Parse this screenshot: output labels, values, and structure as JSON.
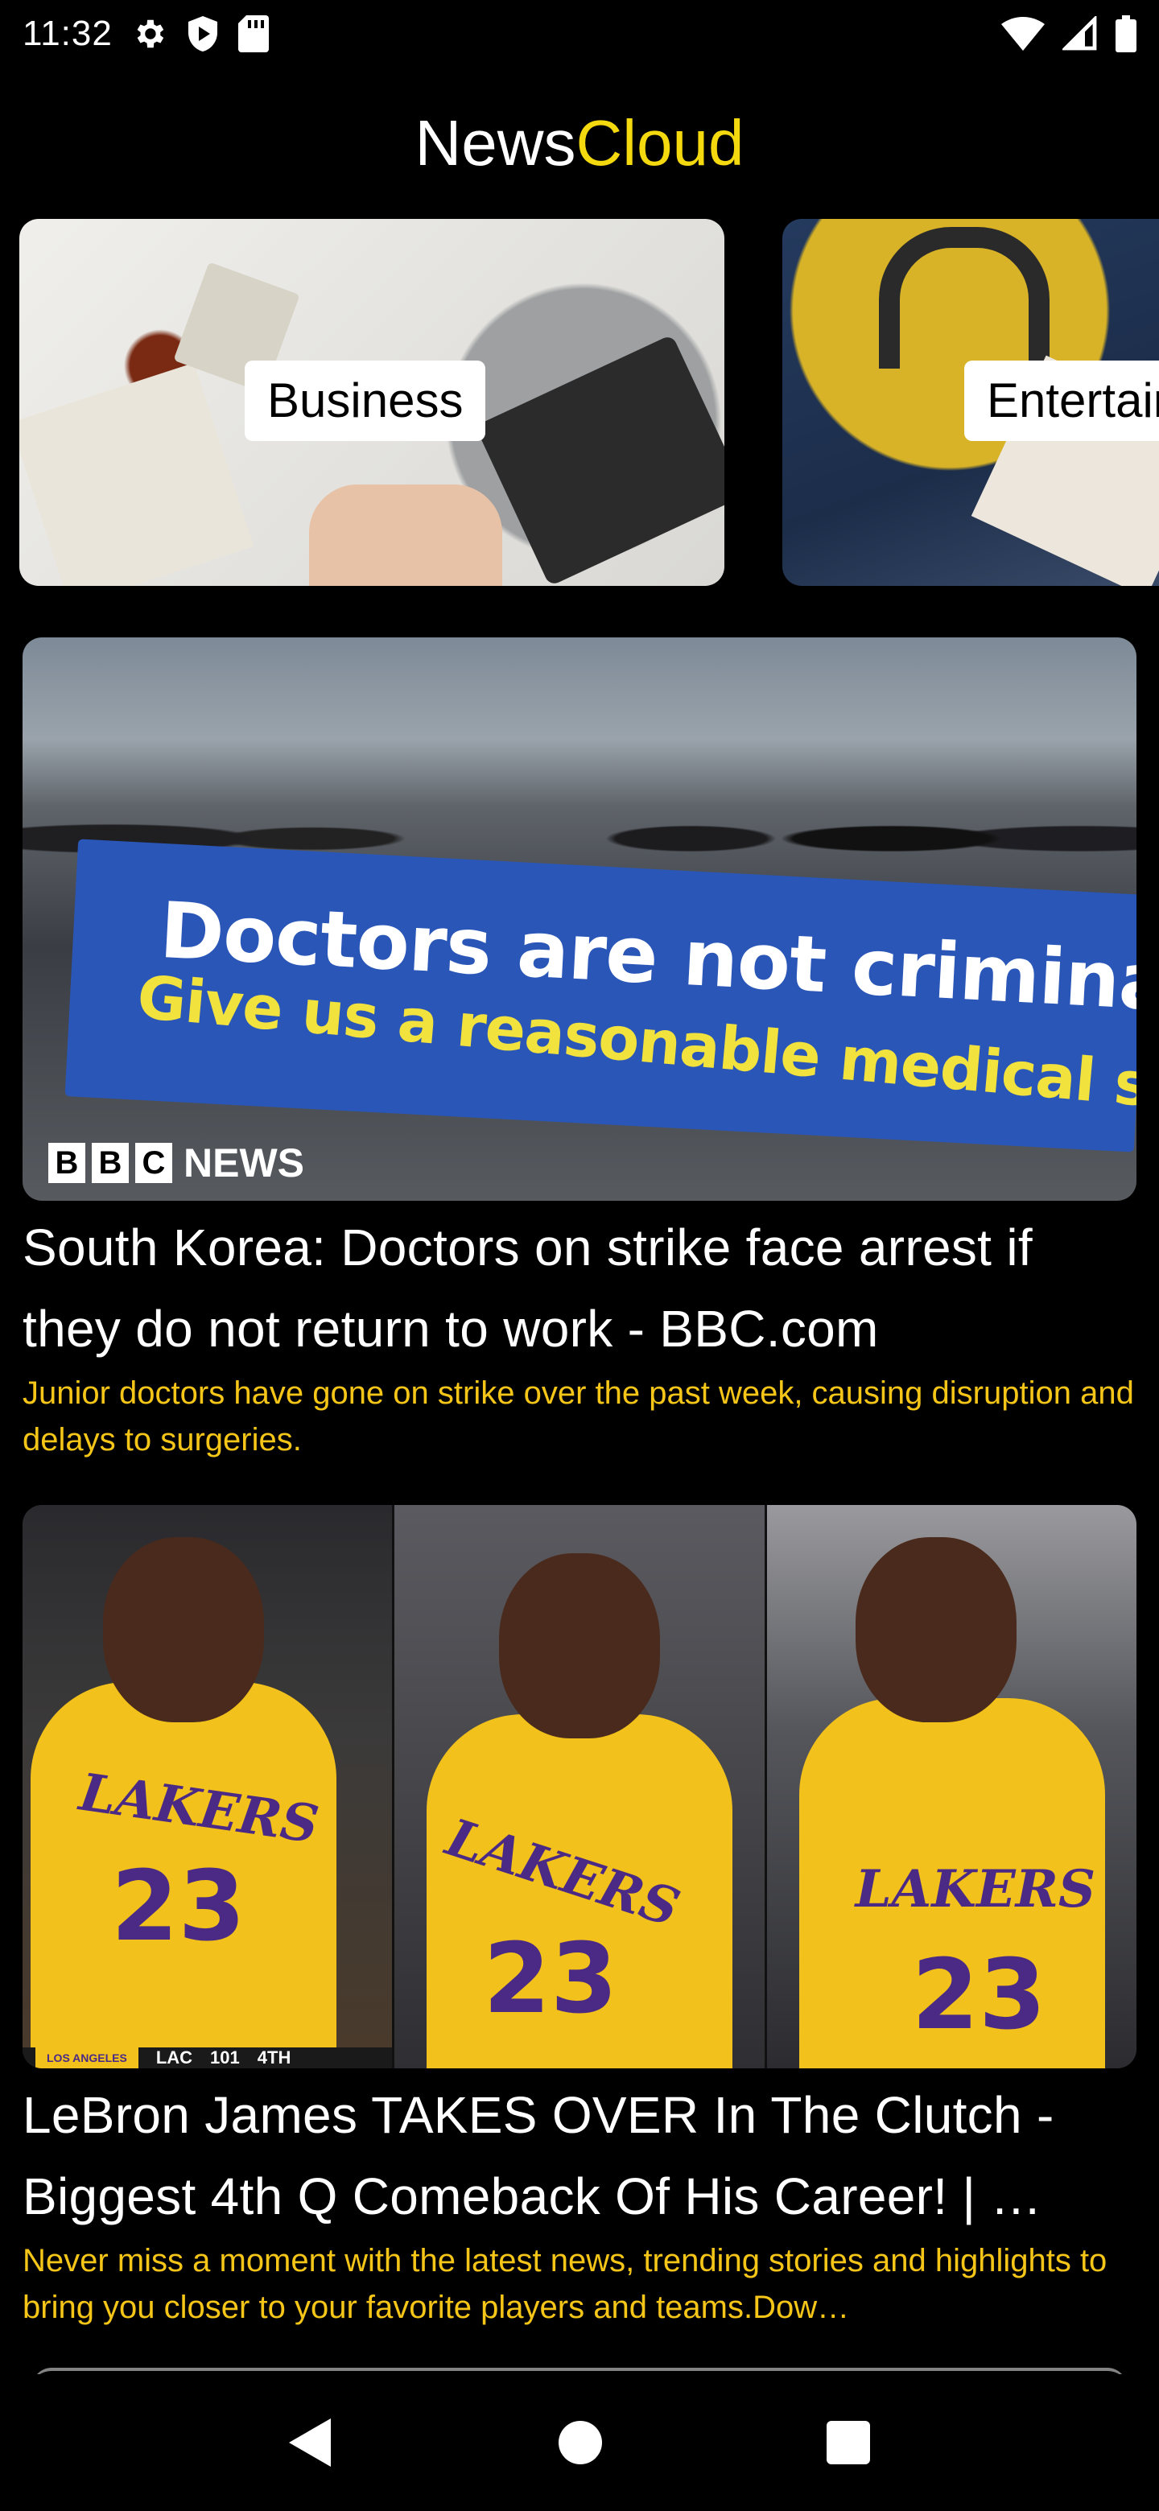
{
  "status_bar": {
    "time": "11:32",
    "left_icons": [
      "gear-icon",
      "shield-play-icon",
      "sd-card-icon"
    ],
    "right_icons": [
      "wifi-icon",
      "signal-icon",
      "battery-icon"
    ]
  },
  "app": {
    "title_part1": "News",
    "title_part2": "Cloud",
    "title_accent_color": "#f5d90f"
  },
  "categories": [
    {
      "label": "Business"
    },
    {
      "label": "Entertain"
    }
  ],
  "articles": [
    {
      "title": "South Korea: Doctors on strike face arrest if they do not return to work - BBC.com",
      "description": "Junior doctors have gone on strike over the past week, causing disruption and delays to surgeries.",
      "image": {
        "banner_line1": "Doctors are not criminals !",
        "banner_line2": "Give us a reasonable medical system",
        "logo_letters": [
          "B",
          "B",
          "C"
        ],
        "logo_word": "NEWS"
      }
    },
    {
      "title": "LeBron James TAKES OVER In The Clutch - Biggest 4th Q Comeback Of His Career! | …",
      "description": "Never miss a moment with the latest news, trending stories and highlights to bring you closer to your favorite players and teams.Dow…",
      "image": {
        "jersey_text": "LAKERS",
        "jersey_number": "23",
        "score_team1": "LOS ANGELES",
        "score_team2": "LAC",
        "score_value": "101",
        "score_quarter": "4TH"
      }
    }
  ],
  "colors": {
    "background": "#000000",
    "description_text": "#f5c518"
  },
  "nav_bar": {
    "buttons": [
      "back-icon",
      "home-icon",
      "recents-icon"
    ]
  }
}
